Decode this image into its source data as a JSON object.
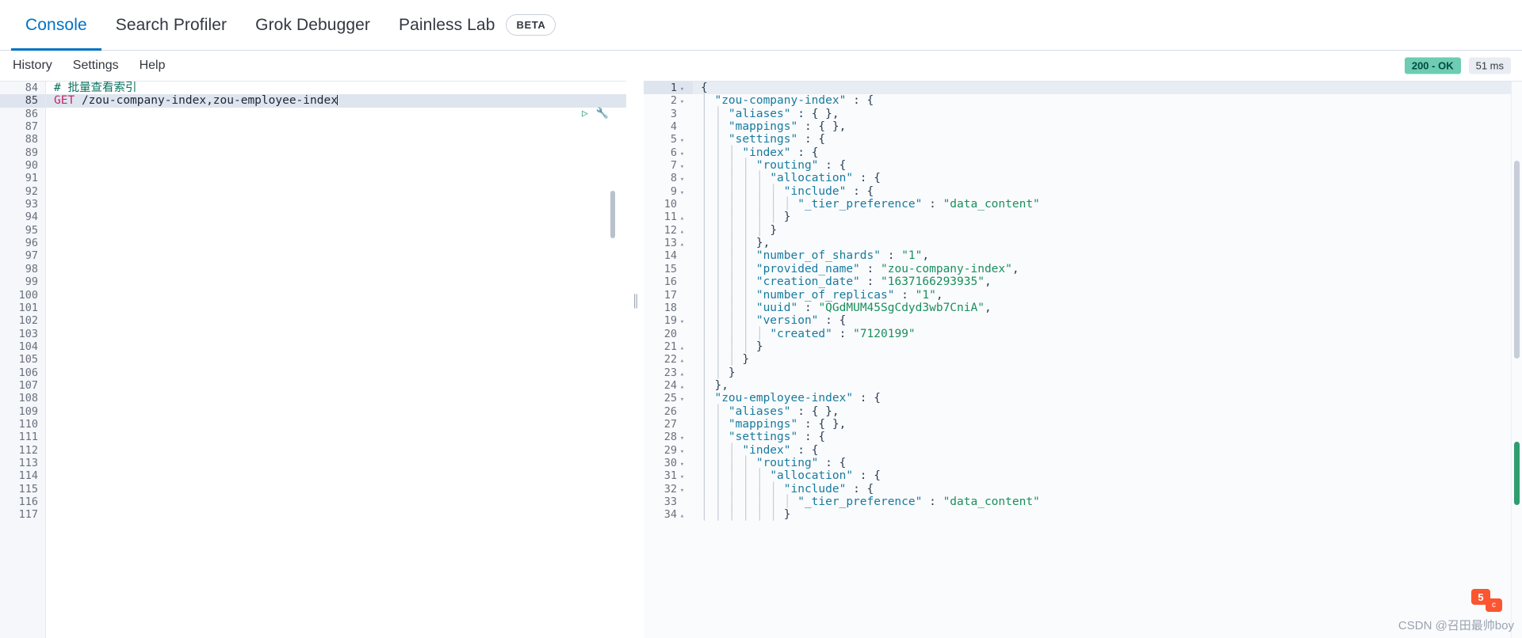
{
  "tabs": [
    {
      "label": "Console",
      "active": true
    },
    {
      "label": "Search Profiler",
      "active": false
    },
    {
      "label": "Grok Debugger",
      "active": false
    },
    {
      "label": "Painless Lab",
      "active": false
    }
  ],
  "beta_badge": "BETA",
  "subnav": [
    {
      "label": "History"
    },
    {
      "label": "Settings"
    },
    {
      "label": "Help"
    }
  ],
  "status": {
    "code": "200 - OK",
    "time": "51 ms",
    "ok_color": "#6dccb1"
  },
  "request_editor": {
    "first_line_number": 84,
    "last_line_number": 117,
    "active_line_number": 85,
    "lines": [
      {
        "n": 84,
        "tokens": [
          {
            "t": "comment",
            "v": "# 批量查看索引"
          }
        ]
      },
      {
        "n": 85,
        "tokens": [
          {
            "t": "method",
            "v": "GET"
          },
          {
            "t": "plain",
            "v": " "
          },
          {
            "t": "url",
            "v": "/zou-company-index,zou-employee-index"
          }
        ],
        "caret": true,
        "active": true
      },
      {
        "n": 86,
        "tokens": []
      },
      {
        "n": 87,
        "tokens": []
      },
      {
        "n": 88,
        "tokens": []
      },
      {
        "n": 89,
        "tokens": []
      },
      {
        "n": 90,
        "tokens": []
      },
      {
        "n": 91,
        "tokens": []
      },
      {
        "n": 92,
        "tokens": []
      },
      {
        "n": 93,
        "tokens": []
      },
      {
        "n": 94,
        "tokens": []
      },
      {
        "n": 95,
        "tokens": []
      },
      {
        "n": 96,
        "tokens": []
      },
      {
        "n": 97,
        "tokens": []
      },
      {
        "n": 98,
        "tokens": []
      },
      {
        "n": 99,
        "tokens": []
      },
      {
        "n": 100,
        "tokens": []
      },
      {
        "n": 101,
        "tokens": []
      },
      {
        "n": 102,
        "tokens": []
      },
      {
        "n": 103,
        "tokens": []
      },
      {
        "n": 104,
        "tokens": []
      },
      {
        "n": 105,
        "tokens": []
      },
      {
        "n": 106,
        "tokens": []
      },
      {
        "n": 107,
        "tokens": []
      },
      {
        "n": 108,
        "tokens": []
      },
      {
        "n": 109,
        "tokens": []
      },
      {
        "n": 110,
        "tokens": []
      },
      {
        "n": 111,
        "tokens": []
      },
      {
        "n": 112,
        "tokens": []
      },
      {
        "n": 113,
        "tokens": []
      },
      {
        "n": 114,
        "tokens": []
      },
      {
        "n": 115,
        "tokens": []
      },
      {
        "n": 116,
        "tokens": []
      },
      {
        "n": 117,
        "tokens": []
      }
    ],
    "actions": {
      "run_icon": "play-icon",
      "wrench_icon": "wrench-icon"
    }
  },
  "response_viewer": {
    "lines": [
      {
        "n": 1,
        "fold": "down",
        "indent": 0,
        "text": "{",
        "active": true
      },
      {
        "n": 2,
        "fold": "down",
        "indent": 1,
        "key": "zou-company-index",
        "after": " : {"
      },
      {
        "n": 3,
        "fold": "",
        "indent": 2,
        "key": "aliases",
        "after": " : { },"
      },
      {
        "n": 4,
        "fold": "",
        "indent": 2,
        "key": "mappings",
        "after": " : { },"
      },
      {
        "n": 5,
        "fold": "down",
        "indent": 2,
        "key": "settings",
        "after": " : {"
      },
      {
        "n": 6,
        "fold": "down",
        "indent": 3,
        "key": "index",
        "after": " : {"
      },
      {
        "n": 7,
        "fold": "down",
        "indent": 4,
        "key": "routing",
        "after": " : {"
      },
      {
        "n": 8,
        "fold": "down",
        "indent": 5,
        "key": "allocation",
        "after": " : {"
      },
      {
        "n": 9,
        "fold": "down",
        "indent": 6,
        "key": "include",
        "after": " : {"
      },
      {
        "n": 10,
        "fold": "",
        "indent": 7,
        "key": "_tier_preference",
        "after": " : ",
        "str": "data_content"
      },
      {
        "n": 11,
        "fold": "up",
        "indent": 6,
        "text": "}"
      },
      {
        "n": 12,
        "fold": "up",
        "indent": 5,
        "text": "}"
      },
      {
        "n": 13,
        "fold": "up",
        "indent": 4,
        "text": "},"
      },
      {
        "n": 14,
        "fold": "",
        "indent": 4,
        "key": "number_of_shards",
        "after": " : ",
        "str": "1",
        "tail": ","
      },
      {
        "n": 15,
        "fold": "",
        "indent": 4,
        "key": "provided_name",
        "after": " : ",
        "str": "zou-company-index",
        "tail": ","
      },
      {
        "n": 16,
        "fold": "",
        "indent": 4,
        "key": "creation_date",
        "after": " : ",
        "str": "1637166293935",
        "tail": ","
      },
      {
        "n": 17,
        "fold": "",
        "indent": 4,
        "key": "number_of_replicas",
        "after": " : ",
        "str": "1",
        "tail": ","
      },
      {
        "n": 18,
        "fold": "",
        "indent": 4,
        "key": "uuid",
        "after": " : ",
        "str": "QGdMUM45SgCdyd3wb7CniA",
        "tail": ","
      },
      {
        "n": 19,
        "fold": "down",
        "indent": 4,
        "key": "version",
        "after": " : {"
      },
      {
        "n": 20,
        "fold": "",
        "indent": 5,
        "key": "created",
        "after": " : ",
        "str": "7120199"
      },
      {
        "n": 21,
        "fold": "up",
        "indent": 4,
        "text": "}"
      },
      {
        "n": 22,
        "fold": "up",
        "indent": 3,
        "text": "}"
      },
      {
        "n": 23,
        "fold": "up",
        "indent": 2,
        "text": "}"
      },
      {
        "n": 24,
        "fold": "up",
        "indent": 1,
        "text": "},"
      },
      {
        "n": 25,
        "fold": "down",
        "indent": 1,
        "key": "zou-employee-index",
        "after": " : {"
      },
      {
        "n": 26,
        "fold": "",
        "indent": 2,
        "key": "aliases",
        "after": " : { },"
      },
      {
        "n": 27,
        "fold": "",
        "indent": 2,
        "key": "mappings",
        "after": " : { },"
      },
      {
        "n": 28,
        "fold": "down",
        "indent": 2,
        "key": "settings",
        "after": " : {"
      },
      {
        "n": 29,
        "fold": "down",
        "indent": 3,
        "key": "index",
        "after": " : {"
      },
      {
        "n": 30,
        "fold": "down",
        "indent": 4,
        "key": "routing",
        "after": " : {"
      },
      {
        "n": 31,
        "fold": "down",
        "indent": 5,
        "key": "allocation",
        "after": " : {"
      },
      {
        "n": 32,
        "fold": "down",
        "indent": 6,
        "key": "include",
        "after": " : {"
      },
      {
        "n": 33,
        "fold": "",
        "indent": 7,
        "key": "_tier_preference",
        "after": " : ",
        "str": "data_content"
      },
      {
        "n": 34,
        "fold": "up",
        "indent": 6,
        "text": "}"
      }
    ]
  },
  "watermark": {
    "text": "CSDN @召田最帅boy",
    "logo_primary": "5",
    "logo_secondary": "c"
  }
}
